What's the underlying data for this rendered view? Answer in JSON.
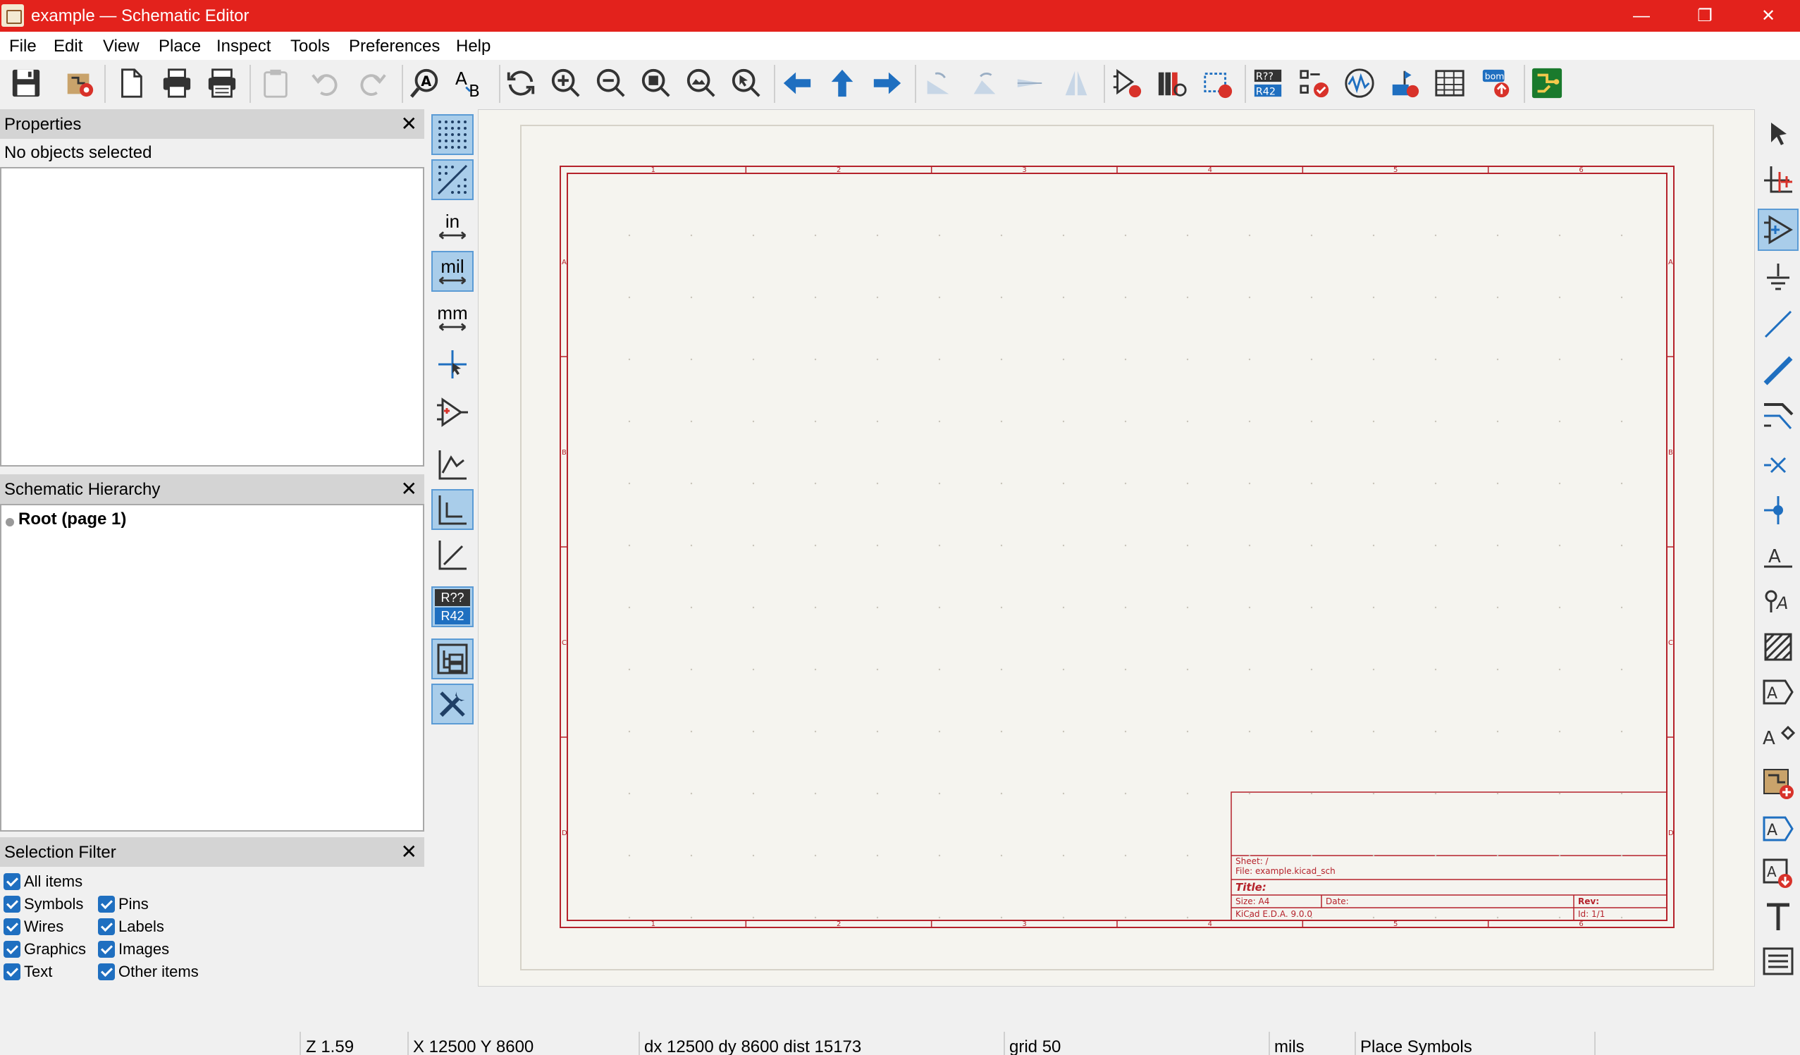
{
  "window": {
    "title": "example — Schematic Editor",
    "controls": {
      "minimize": "—",
      "restore": "❐",
      "close": "✕"
    }
  },
  "menu": [
    "File",
    "Edit",
    "View",
    "Place",
    "Inspect",
    "Tools",
    "Preferences",
    "Help"
  ],
  "toolbar_icons": [
    "save-icon",
    "schematic-setup-icon",
    "page-settings-icon",
    "print-icon",
    "plot-icon",
    "paste-icon",
    "undo-icon",
    "redo-icon",
    "find-icon",
    "find-replace-icon",
    "refresh-icon",
    "zoom-in-icon",
    "zoom-out-icon",
    "zoom-fit-icon",
    "zoom-objects-icon",
    "zoom-selection-icon",
    "navigate-back-icon",
    "navigate-up-icon",
    "navigate-forward-icon",
    "rotate-ccw-icon",
    "rotate-cw-icon",
    "mirror-v-icon",
    "mirror-h-icon",
    "symbol-editor-icon",
    "symbol-library-icon",
    "footprint-assign-icon",
    "annotate-icon",
    "erc-icon",
    "simulator-icon",
    "netlist-icon",
    "symbol-fields-table-icon",
    "bom-icon",
    "pcb-editor-icon"
  ],
  "panels": {
    "properties": {
      "title": "Properties",
      "status": "No objects selected"
    },
    "hierarchy": {
      "title": "Schematic Hierarchy",
      "root": "Root (page 1)"
    },
    "selection_filter": {
      "title": "Selection Filter",
      "items": [
        {
          "label": "All items",
          "checked": true
        },
        {
          "label": "Symbols",
          "checked": true
        },
        {
          "label": "Pins",
          "checked": true
        },
        {
          "label": "Wires",
          "checked": true
        },
        {
          "label": "Labels",
          "checked": true
        },
        {
          "label": "Graphics",
          "checked": true
        },
        {
          "label": "Images",
          "checked": true
        },
        {
          "label": "Text",
          "checked": true
        },
        {
          "label": "Other items",
          "checked": true
        }
      ]
    },
    "close_symbol": "✕"
  },
  "left_tools": {
    "units_in": "in",
    "units_mil": "mil",
    "units_mm": "mm",
    "annotate_top": "R??",
    "annotate_bottom": "R42"
  },
  "right_toolbar_icons": [
    "select-icon",
    "highlight-net-icon",
    "add-symbol-icon",
    "add-power-icon",
    "add-wire-icon",
    "add-bus-icon",
    "bus-entry-icon",
    "no-connect-icon",
    "junction-icon",
    "net-label-icon",
    "class-directive-icon",
    "rule-area-icon",
    "global-label-icon",
    "hierarchical-label-icon",
    "add-sheet-icon",
    "import-sheet-pin-icon",
    "sheet-pin-icon",
    "add-text-icon",
    "add-textbox-icon"
  ],
  "sheet": {
    "col_labels": [
      "1",
      "2",
      "3",
      "4",
      "5",
      "6"
    ],
    "row_labels": [
      "A",
      "B",
      "C",
      "D"
    ],
    "title_block": {
      "sheet": "Sheet: /",
      "file": "File: example.kicad_sch",
      "title": "Title:",
      "size": "Size: A4",
      "date": "Date:",
      "rev": "Rev:",
      "kicad": "KiCad E.D.A. 9.0.0",
      "id": "Id: 1/1"
    }
  },
  "status": {
    "zoom": "Z 1.59",
    "coords": "X 12500  Y 8600",
    "delta": "dx 12500  dy 8600  dist 15173",
    "grid": "grid 50",
    "units": "mils",
    "mode": "Place Symbols"
  },
  "colors": {
    "titlebar": "#e3221c",
    "sheet_border": "#b5222b",
    "accent": "#1f6fc0"
  }
}
